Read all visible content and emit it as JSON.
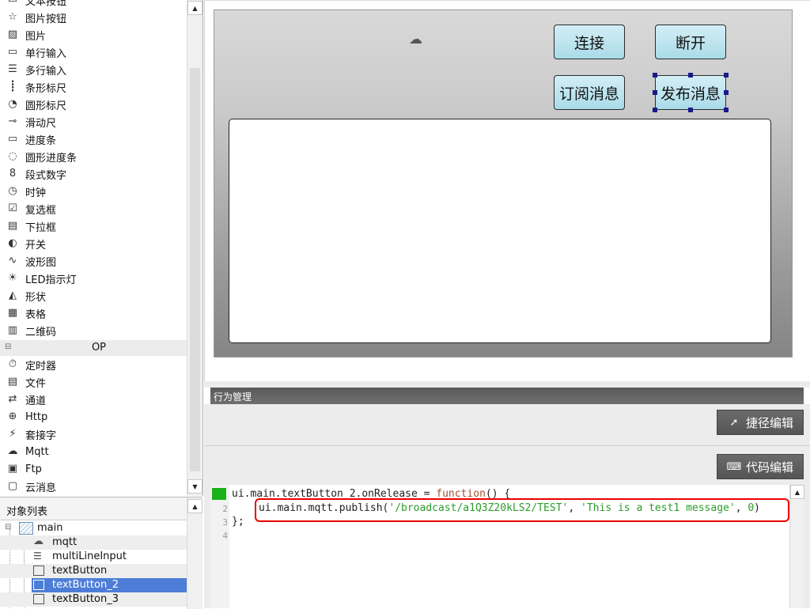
{
  "palette": {
    "items": [
      {
        "icon": "text-button-icon",
        "label": "文本按钮"
      },
      {
        "icon": "image-button-icon",
        "label": "图片按钮"
      },
      {
        "icon": "image-icon",
        "label": "图片"
      },
      {
        "icon": "single-line-input-icon",
        "label": "单行输入"
      },
      {
        "icon": "multi-line-input-icon",
        "label": "多行输入"
      },
      {
        "icon": "bar-gauge-icon",
        "label": "条形标尺"
      },
      {
        "icon": "round-gauge-icon",
        "label": "圆形标尺"
      },
      {
        "icon": "slider-icon",
        "label": "滑动尺"
      },
      {
        "icon": "progress-bar-icon",
        "label": "进度条"
      },
      {
        "icon": "round-progress-icon",
        "label": "圆形进度条"
      },
      {
        "icon": "segment-digit-icon",
        "label": "段式数字"
      },
      {
        "icon": "clock-icon",
        "label": "时钟"
      },
      {
        "icon": "checkbox-icon",
        "label": "复选框"
      },
      {
        "icon": "dropdown-icon",
        "label": "下拉框"
      },
      {
        "icon": "switch-icon",
        "label": "开关"
      },
      {
        "icon": "waveform-icon",
        "label": "波形图"
      },
      {
        "icon": "led-icon",
        "label": "LED指示灯"
      },
      {
        "icon": "shape-icon",
        "label": "形状"
      },
      {
        "icon": "table-icon",
        "label": "表格"
      },
      {
        "icon": "qrcode-icon",
        "label": "二维码"
      }
    ],
    "section_op": "OP",
    "op_items": [
      {
        "icon": "timer-icon",
        "label": "定时器"
      },
      {
        "icon": "file-icon",
        "label": "文件"
      },
      {
        "icon": "channel-icon",
        "label": "通道"
      },
      {
        "icon": "globe-icon",
        "label": "Http"
      },
      {
        "icon": "socket-icon",
        "label": "套接字"
      },
      {
        "icon": "mqtt-icon",
        "label": "Mqtt"
      },
      {
        "icon": "ftp-icon",
        "label": "Ftp"
      },
      {
        "icon": "cloud-message-icon",
        "label": "云消息"
      }
    ]
  },
  "object_list": {
    "title": "对象列表",
    "nodes": [
      "main",
      "mqtt",
      "multiLineInput",
      "textButton",
      "textButton_2",
      "textButton_3"
    ],
    "selected": "textButton_2"
  },
  "form": {
    "connect_label": "连接",
    "disconnect_label": "断开",
    "subscribe_label": "订阅消息",
    "publish_label": "发布消息"
  },
  "behavior": {
    "title": "行为管理",
    "quick_edit": "捷径编辑",
    "code_edit": "代码编辑"
  },
  "code": {
    "line_numbers": [
      "1",
      "2",
      "3",
      "4"
    ],
    "line1_a": "ui.main.textButton_2.onRelease = ",
    "line1_kw": "function",
    "line1_b": "() {",
    "line2_a": "ui.main.mqtt.publish(",
    "line2_s1": "'/broadcast/a1Q3Z20kLS2/TEST'",
    "line2_c": ", ",
    "line2_s2": "'This is a test1 message'",
    "line2_d": ", ",
    "line2_n": "0",
    "line2_e": ")",
    "line3": "};"
  },
  "colors": {
    "button_fill": "#b9e3ee",
    "selection": "#4d7dd6",
    "highlight_box": "#e00000",
    "marker": "#19b219"
  }
}
